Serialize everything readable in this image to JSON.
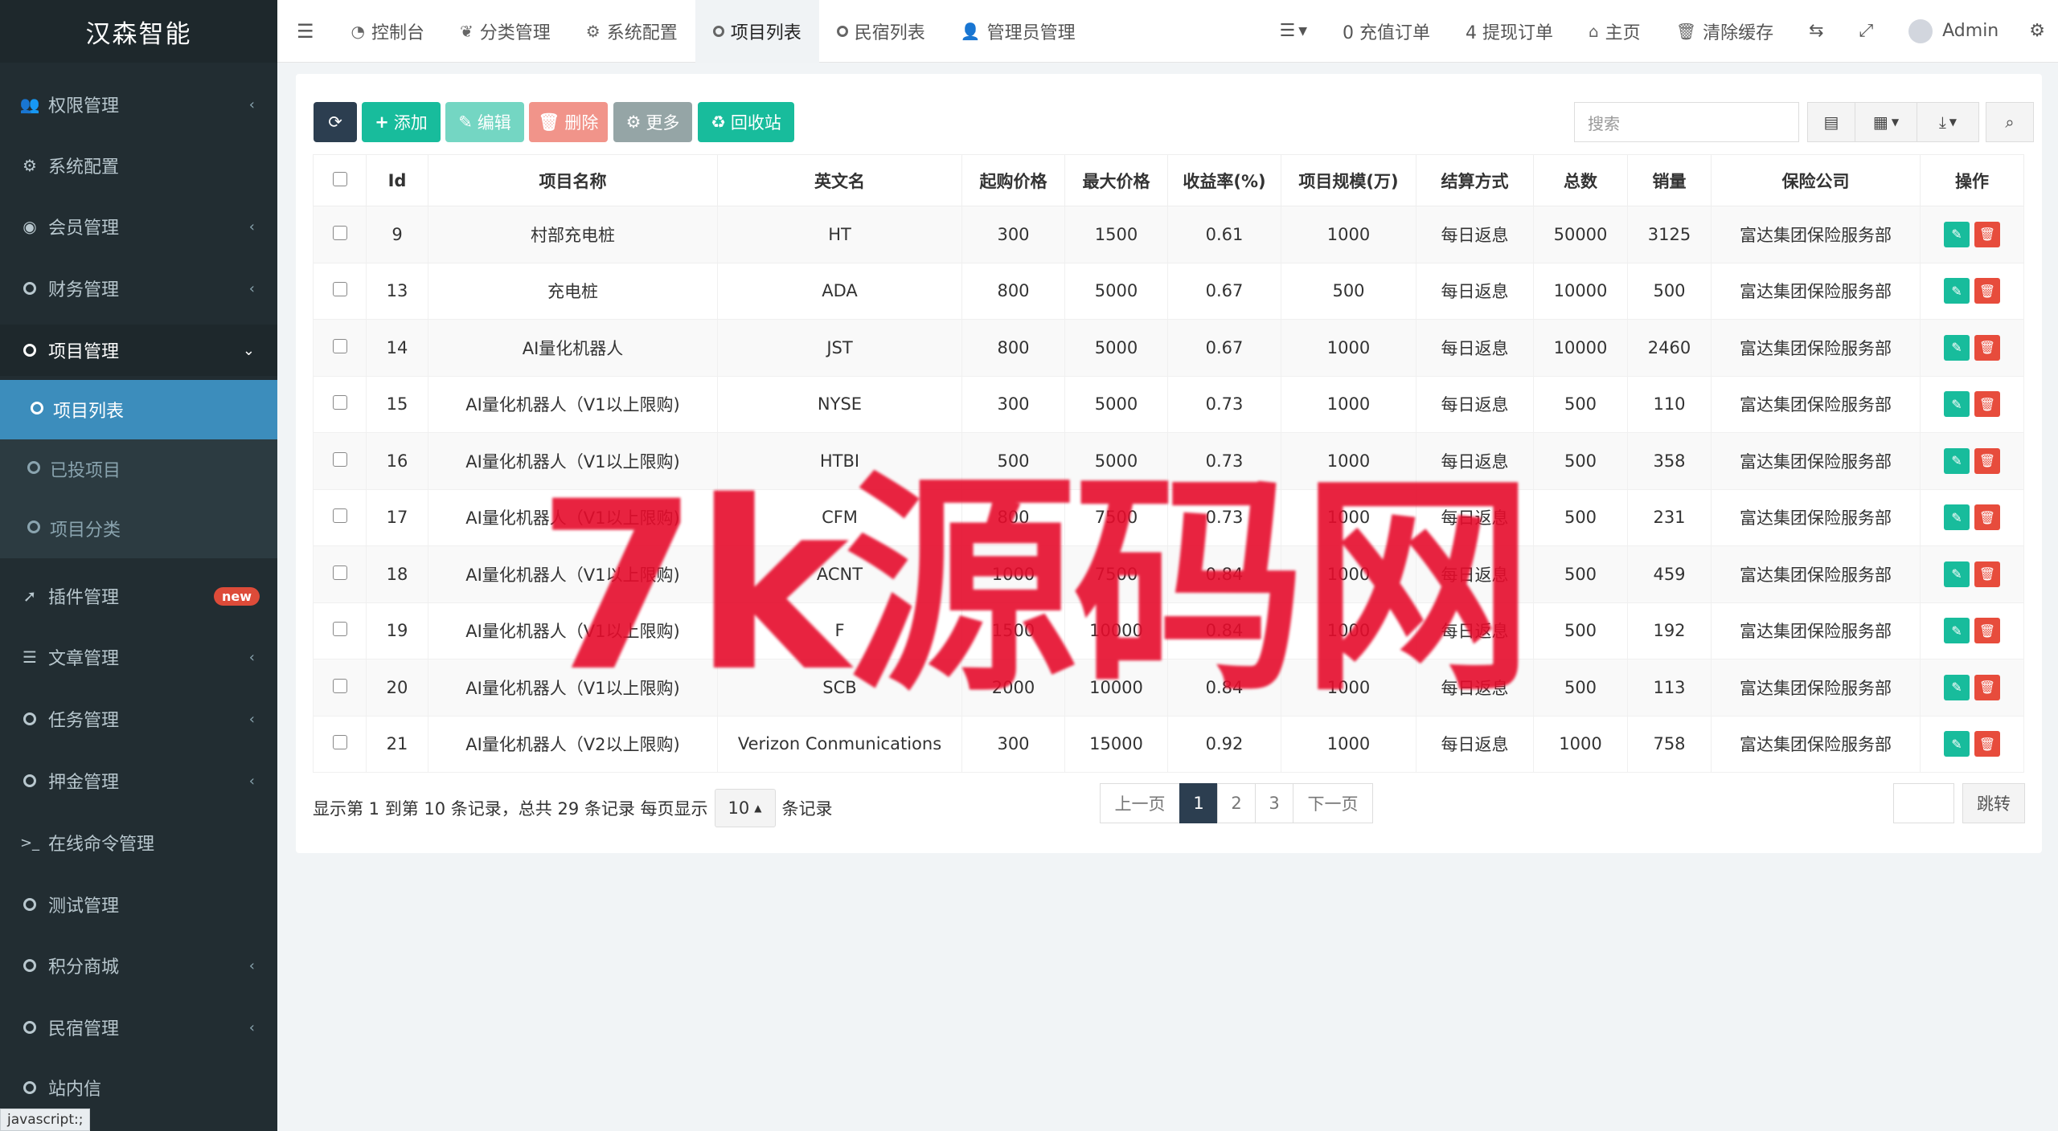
{
  "brand": "汉森智能",
  "sidebar": {
    "items": [
      {
        "label": "权限管理",
        "icon": "users-icon",
        "chevron": "‹"
      },
      {
        "label": "系统配置",
        "icon": "gear-icon",
        "chevron": ""
      },
      {
        "label": "会员管理",
        "icon": "user-circle-icon",
        "chevron": "‹"
      },
      {
        "label": "财务管理",
        "icon": "circle-icon",
        "chevron": "‹"
      },
      {
        "label": "项目管理",
        "icon": "circle-icon",
        "chevron": "⌄"
      },
      {
        "label": "插件管理",
        "icon": "rocket-icon",
        "chevron": "",
        "badge": "new"
      },
      {
        "label": "文章管理",
        "icon": "list-icon",
        "chevron": "‹"
      },
      {
        "label": "任务管理",
        "icon": "circle-icon",
        "chevron": "‹"
      },
      {
        "label": "押金管理",
        "icon": "circle-icon",
        "chevron": "‹"
      },
      {
        "label": "在线命令管理",
        "icon": "terminal-icon",
        "chevron": ""
      },
      {
        "label": "测试管理",
        "icon": "circle-icon",
        "chevron": ""
      },
      {
        "label": "积分商城",
        "icon": "circle-icon",
        "chevron": "‹"
      },
      {
        "label": "民宿管理",
        "icon": "circle-icon",
        "chevron": "‹"
      },
      {
        "label": "站内信",
        "icon": "circle-icon",
        "chevron": ""
      }
    ],
    "subitems": [
      {
        "label": "项目列表"
      },
      {
        "label": "已投项目"
      },
      {
        "label": "项目分类"
      }
    ]
  },
  "topbar": {
    "tabs": [
      {
        "label": "控制台",
        "icon": "dashboard-icon"
      },
      {
        "label": "分类管理",
        "icon": "leaf-icon"
      },
      {
        "label": "系统配置",
        "icon": "gear-icon"
      },
      {
        "label": "项目列表",
        "icon": "circle-icon"
      },
      {
        "label": "民宿列表",
        "icon": "circle-icon"
      },
      {
        "label": "管理员管理",
        "icon": "user-icon"
      }
    ],
    "recharge_orders": "0 充值订单",
    "withdraw_orders": "4 提现订单",
    "home": "主页",
    "clear_cache": "清除缓存",
    "admin": "Admin"
  },
  "toolbar": {
    "add": "添加",
    "edit": "编辑",
    "delete": "删除",
    "more": "更多",
    "recycle": "回收站",
    "search_placeholder": "搜索"
  },
  "table": {
    "headers": [
      "Id",
      "项目名称",
      "英文名",
      "起购价格",
      "最大价格",
      "收益率(%)",
      "项目规模(万)",
      "结算方式",
      "总数",
      "销量",
      "保险公司",
      "操作"
    ],
    "rows": [
      {
        "id": "9",
        "name": "村部充电桩",
        "en": "HT",
        "min": "300",
        "max": "1500",
        "rate": "0.61",
        "scale": "1000",
        "settle": "每日返息",
        "total": "50000",
        "sales": "3125",
        "insurer": "富达集团保险服务部"
      },
      {
        "id": "13",
        "name": "充电桩",
        "en": "ADA",
        "min": "800",
        "max": "5000",
        "rate": "0.67",
        "scale": "500",
        "settle": "每日返息",
        "total": "10000",
        "sales": "500",
        "insurer": "富达集团保险服务部"
      },
      {
        "id": "14",
        "name": "AI量化机器人",
        "en": "JST",
        "min": "800",
        "max": "5000",
        "rate": "0.67",
        "scale": "1000",
        "settle": "每日返息",
        "total": "10000",
        "sales": "2460",
        "insurer": "富达集团保险服务部"
      },
      {
        "id": "15",
        "name": "AI量化机器人（V1以上限购)",
        "en": "NYSE",
        "min": "300",
        "max": "5000",
        "rate": "0.73",
        "scale": "1000",
        "settle": "每日返息",
        "total": "500",
        "sales": "110",
        "insurer": "富达集团保险服务部"
      },
      {
        "id": "16",
        "name": "AI量化机器人（V1以上限购)",
        "en": "HTBI",
        "min": "500",
        "max": "5000",
        "rate": "0.73",
        "scale": "1000",
        "settle": "每日返息",
        "total": "500",
        "sales": "358",
        "insurer": "富达集团保险服务部"
      },
      {
        "id": "17",
        "name": "AI量化机器人（V1以上限购)",
        "en": "CFM",
        "min": "800",
        "max": "7500",
        "rate": "0.73",
        "scale": "1000",
        "settle": "每日返息",
        "total": "500",
        "sales": "231",
        "insurer": "富达集团保险服务部"
      },
      {
        "id": "18",
        "name": "AI量化机器人（V1以上限购)",
        "en": "ACNT",
        "min": "1000",
        "max": "7500",
        "rate": "0.84",
        "scale": "1000",
        "settle": "每日返息",
        "total": "500",
        "sales": "459",
        "insurer": "富达集团保险服务部"
      },
      {
        "id": "19",
        "name": "AI量化机器人（V1以上限购)",
        "en": "F",
        "min": "1500",
        "max": "10000",
        "rate": "0.84",
        "scale": "1000",
        "settle": "每日返息",
        "total": "500",
        "sales": "192",
        "insurer": "富达集团保险服务部"
      },
      {
        "id": "20",
        "name": "AI量化机器人（V1以上限购)",
        "en": "SCB",
        "min": "2000",
        "max": "10000",
        "rate": "0.84",
        "scale": "1000",
        "settle": "每日返息",
        "total": "500",
        "sales": "113",
        "insurer": "富达集团保险服务部"
      },
      {
        "id": "21",
        "name": "AI量化机器人（V2以上限购)",
        "en": "Verizon Conmunications",
        "min": "300",
        "max": "15000",
        "rate": "0.92",
        "scale": "1000",
        "settle": "每日返息",
        "total": "1000",
        "sales": "758",
        "insurer": "富达集团保险服务部"
      }
    ]
  },
  "pagination": {
    "info_prefix": "显示第 1 到第 10 条记录，总共 29 条记录 每页显示",
    "page_size": "10",
    "info_suffix": "条记录",
    "prev": "上一页",
    "pages": [
      "1",
      "2",
      "3"
    ],
    "current": "1",
    "next": "下一页",
    "jump": "跳转"
  },
  "watermark": "7k源码网",
  "statusbar": "javascript:;"
}
